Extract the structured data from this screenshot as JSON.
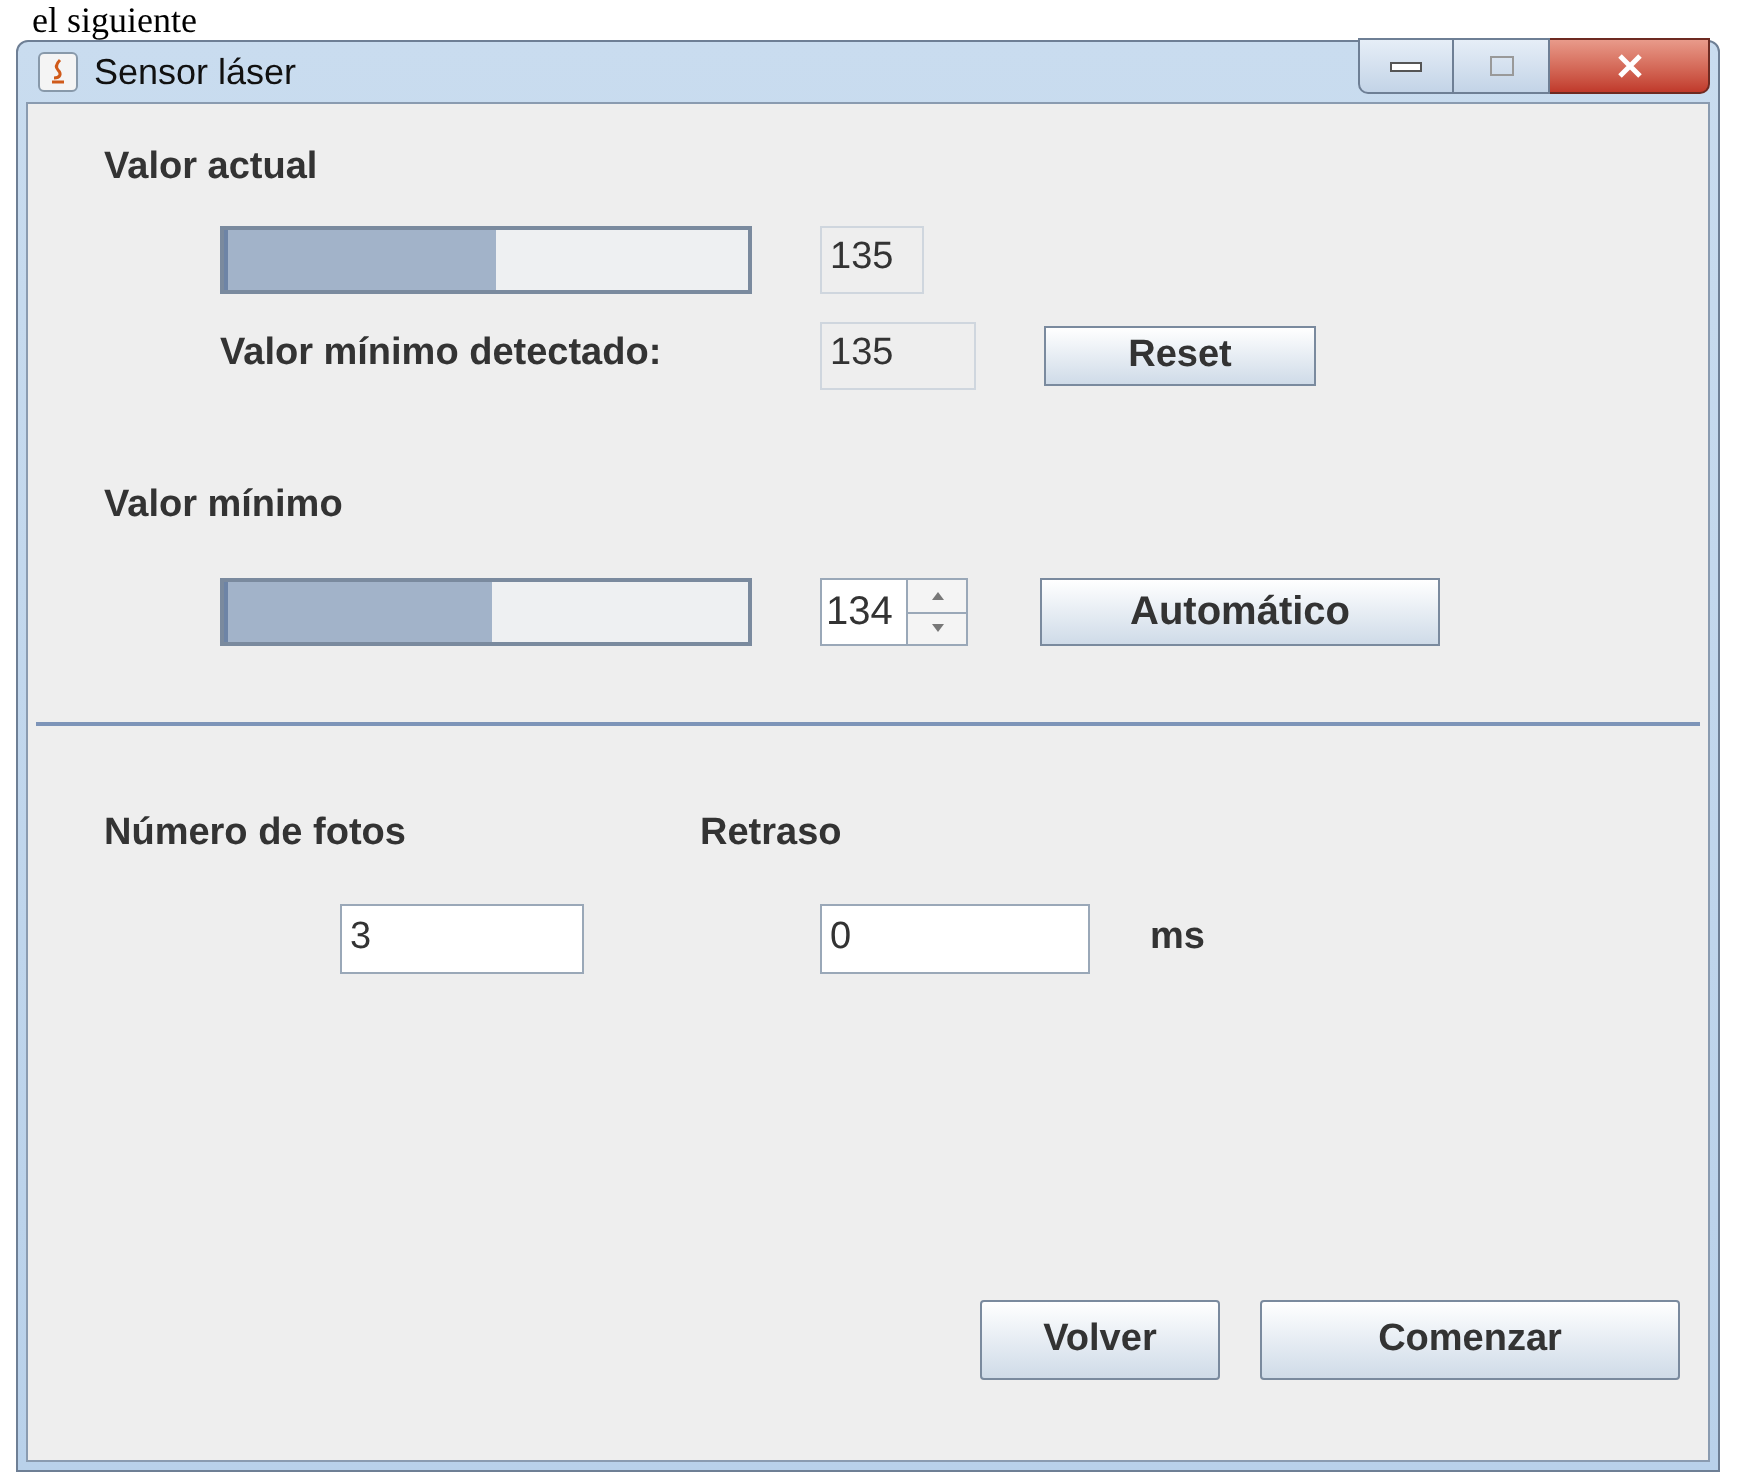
{
  "page_text": "el siguiente",
  "window": {
    "title": "Sensor láser"
  },
  "current": {
    "label": "Valor actual",
    "level": 0.52,
    "reading": "135",
    "min_label": "Valor mínimo detectado:",
    "min_value": "135",
    "reset_button": "Reset"
  },
  "minimum": {
    "label": "Valor mínimo",
    "level": 0.51,
    "spinner_value": "134",
    "auto_button": "Automático"
  },
  "photos": {
    "label": "Número de fotos",
    "value": "3"
  },
  "delay": {
    "label": "Retraso",
    "value": "0",
    "unit": "ms"
  },
  "buttons": [
    "Volver",
    "Comenzar"
  ]
}
